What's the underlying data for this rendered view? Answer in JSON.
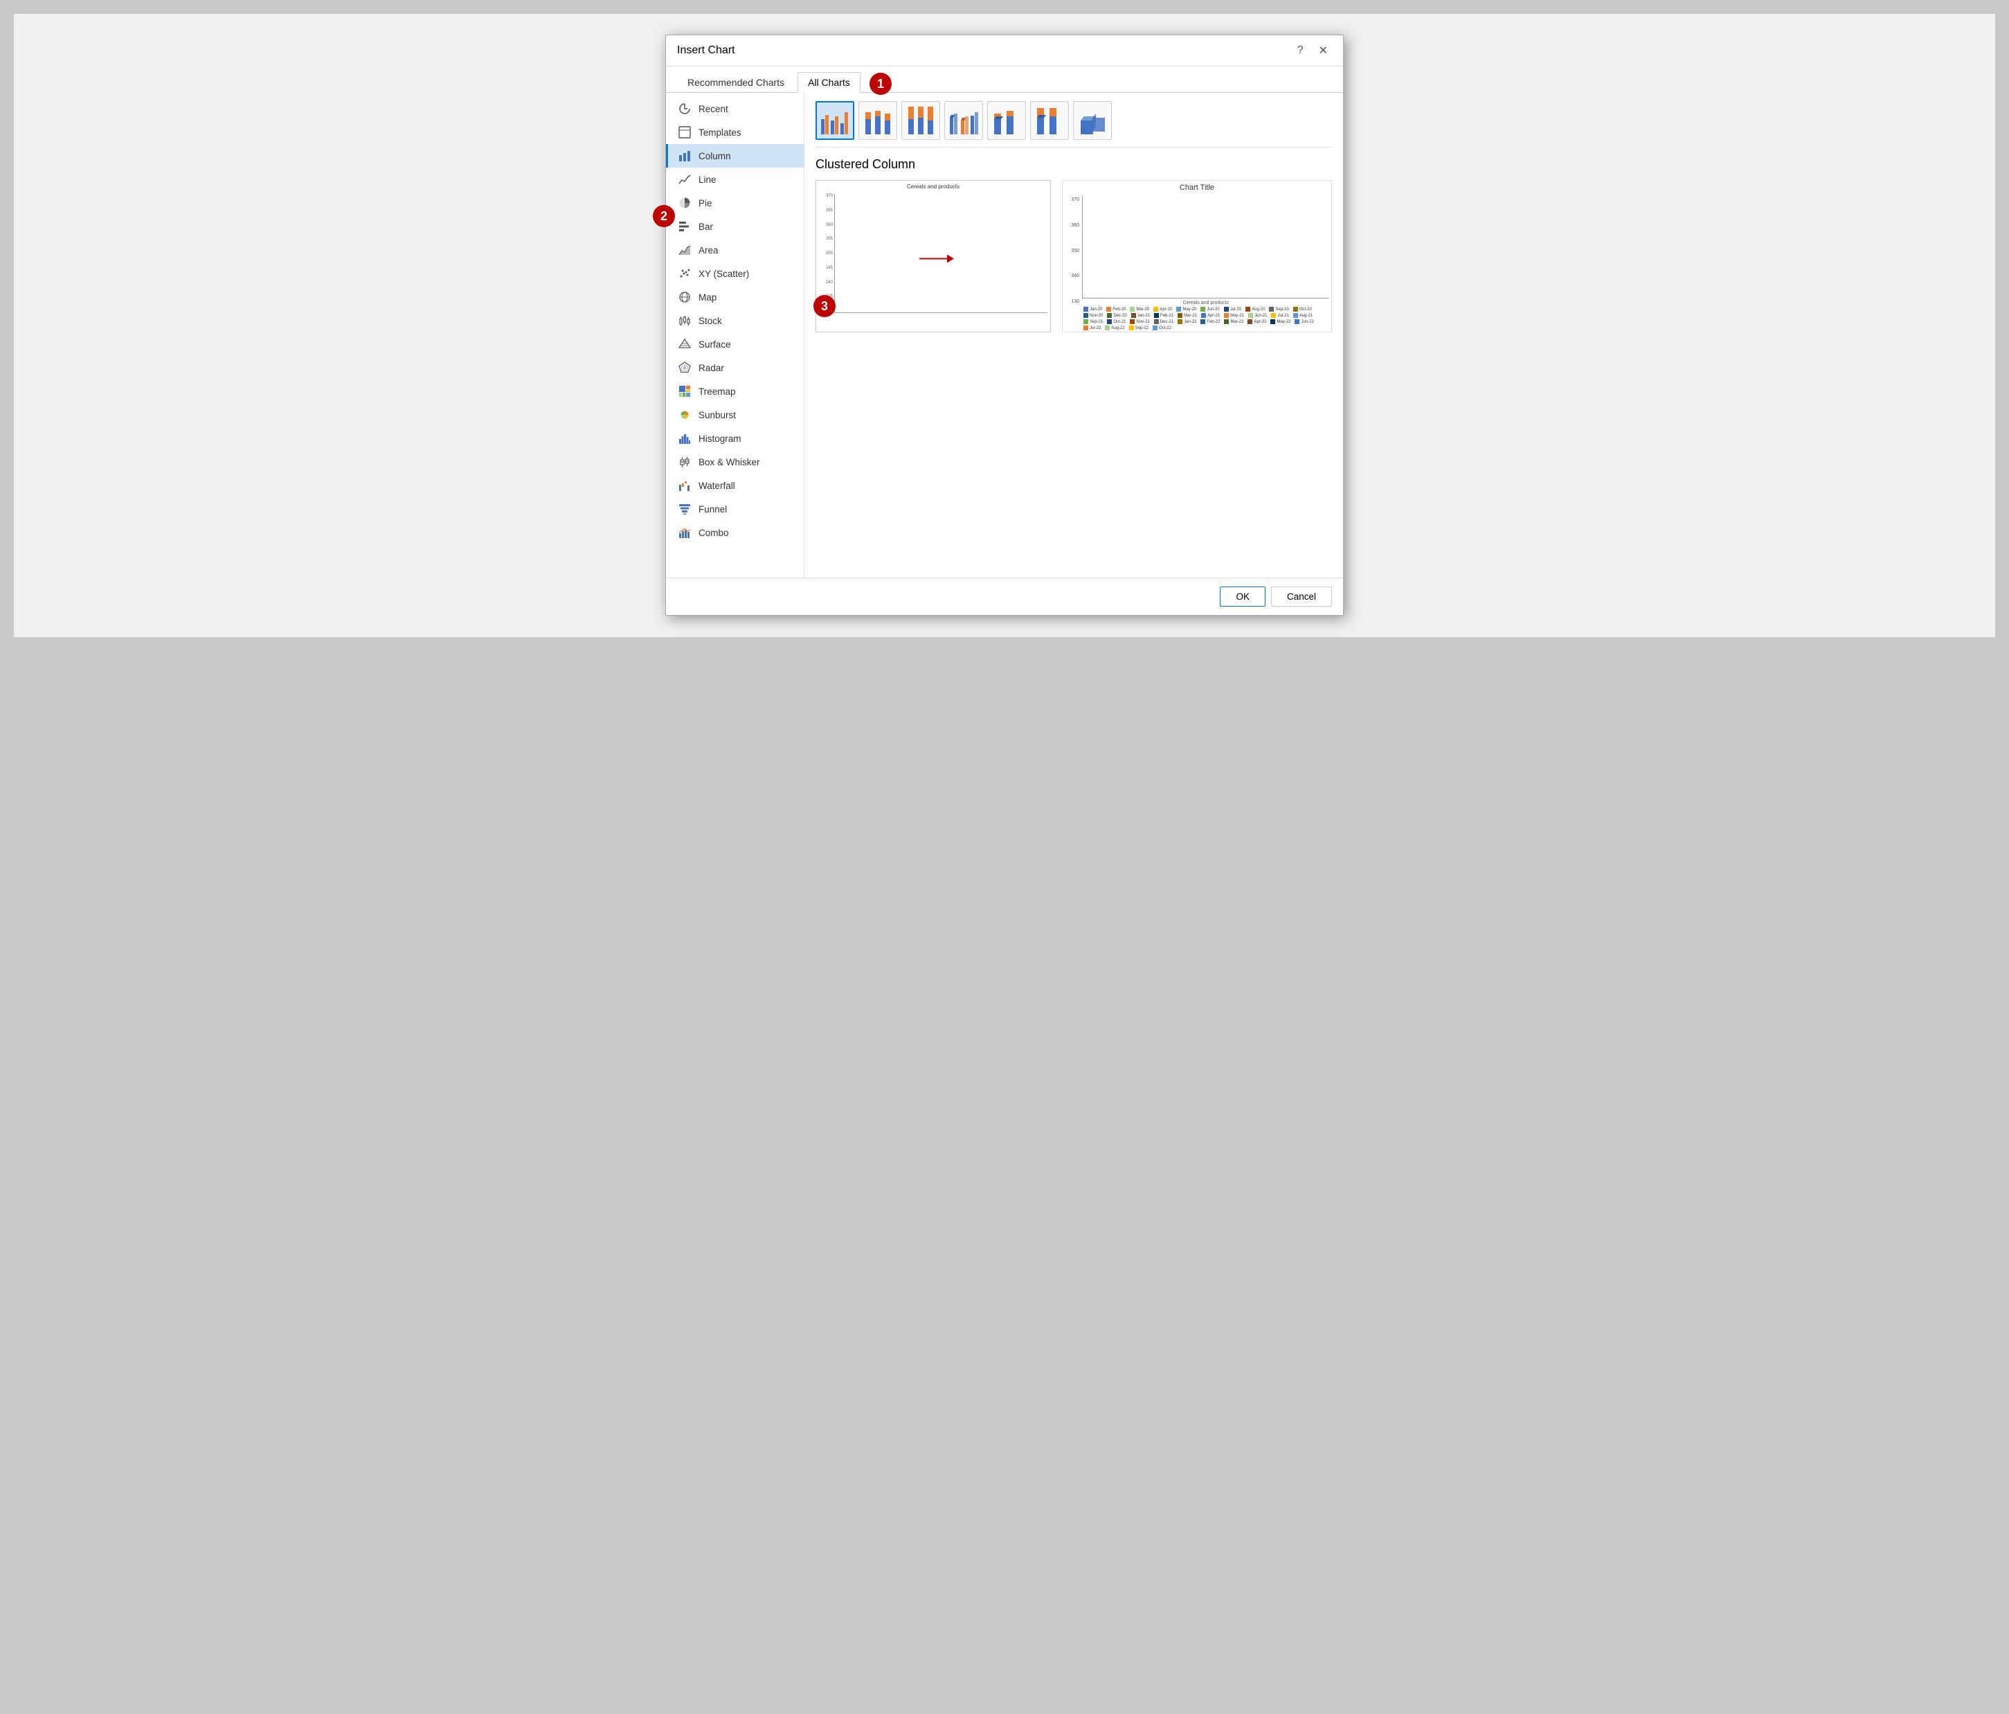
{
  "dialog": {
    "title": "Insert Chart",
    "help_label": "?",
    "close_label": "✕"
  },
  "tabs": [
    {
      "id": "recommended",
      "label": "Recommended Charts",
      "active": false
    },
    {
      "id": "all",
      "label": "All Charts",
      "active": true
    }
  ],
  "sidebar": {
    "items": [
      {
        "id": "recent",
        "label": "Recent",
        "icon": "↺",
        "selected": false
      },
      {
        "id": "templates",
        "label": "Templates",
        "icon": "▭",
        "selected": false
      },
      {
        "id": "column",
        "label": "Column",
        "icon": "bar",
        "selected": true
      },
      {
        "id": "line",
        "label": "Line",
        "icon": "line",
        "selected": false
      },
      {
        "id": "pie",
        "label": "Pie",
        "icon": "pie",
        "selected": false
      },
      {
        "id": "bar",
        "label": "Bar",
        "icon": "hbar",
        "selected": false
      },
      {
        "id": "area",
        "label": "Area",
        "icon": "area",
        "selected": false
      },
      {
        "id": "scatter",
        "label": "XY (Scatter)",
        "icon": "scatter",
        "selected": false
      },
      {
        "id": "map",
        "label": "Map",
        "icon": "map",
        "selected": false
      },
      {
        "id": "stock",
        "label": "Stock",
        "icon": "stock",
        "selected": false
      },
      {
        "id": "surface",
        "label": "Surface",
        "icon": "surface",
        "selected": false
      },
      {
        "id": "radar",
        "label": "Radar",
        "icon": "radar",
        "selected": false
      },
      {
        "id": "treemap",
        "label": "Treemap",
        "icon": "treemap",
        "selected": false
      },
      {
        "id": "sunburst",
        "label": "Sunburst",
        "icon": "sunburst",
        "selected": false
      },
      {
        "id": "histogram",
        "label": "Histogram",
        "icon": "histogram",
        "selected": false
      },
      {
        "id": "boxwhisker",
        "label": "Box & Whisker",
        "icon": "boxwhisker",
        "selected": false
      },
      {
        "id": "waterfall",
        "label": "Waterfall",
        "icon": "waterfall",
        "selected": false
      },
      {
        "id": "funnel",
        "label": "Funnel",
        "icon": "funnel",
        "selected": false
      },
      {
        "id": "combo",
        "label": "Combo",
        "icon": "combo",
        "selected": false
      }
    ]
  },
  "chart_subtypes": [
    {
      "id": "clustered_col",
      "label": "Clustered Column",
      "selected": true
    },
    {
      "id": "stacked_col",
      "label": "Stacked Column",
      "selected": false
    },
    {
      "id": "100pct_stacked_col",
      "label": "100% Stacked Column",
      "selected": false
    },
    {
      "id": "clustered_col_3d",
      "label": "3-D Clustered Column",
      "selected": false
    },
    {
      "id": "stacked_col_3d",
      "label": "3-D Stacked Column",
      "selected": false
    },
    {
      "id": "pct_stacked_col_3d",
      "label": "3-D 100% Stacked Column",
      "selected": false
    },
    {
      "id": "3d_col",
      "label": "3-D Column",
      "selected": false
    }
  ],
  "selected_chart_name": "Clustered Column",
  "preview": {
    "small_title": "Cereals and products",
    "large_title": "Chart Title",
    "y_labels": [
      "370",
      "365",
      "360",
      "355",
      "350",
      "345",
      "340",
      "335",
      "130"
    ]
  },
  "footer": {
    "ok_label": "OK",
    "cancel_label": "Cancel"
  },
  "badges": {
    "b1_label": "1",
    "b2_label": "2",
    "b3_label": "3"
  },
  "colors": {
    "accent": "#0078d4",
    "badge_bg": "#c00000",
    "selected_bg": "#d0e4f7",
    "selected_border": "#0078d4"
  }
}
